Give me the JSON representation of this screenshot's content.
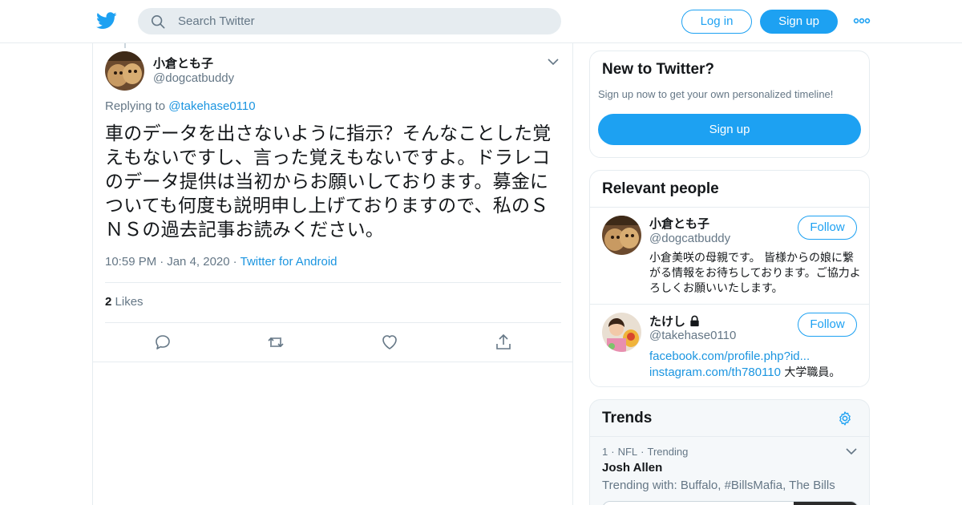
{
  "topbar": {
    "logo_icon": "twitter-bird-icon",
    "search_placeholder": "Search Twitter",
    "login_label": "Log in",
    "signup_label": "Sign up",
    "more_icon": "more-dots-icon",
    "brand_color": "#1da1f2"
  },
  "tweet": {
    "display_name": "小倉とも子",
    "screen_name": "@dogcatbuddy",
    "replying_prefix": "Replying to",
    "replying_to": "@takehase0110",
    "text": "車のデータを出さないように指示？そんなことした覚えもないですし、言った覚えもないですよ。ドラレコのデータ提供は当初からお願いしております。募金についても何度も説明申し上げておりますので、私のＳＮＳの過去記事お読みください。",
    "time": "10:59 PM",
    "date": "Jan 4, 2020",
    "source": "Twitter for Android",
    "likes_count": "2",
    "likes_label": "Likes",
    "actions": [
      "reply-icon",
      "retweet-icon",
      "like-icon",
      "share-icon"
    ]
  },
  "sidebar": {
    "new_to_twitter": {
      "title": "New to Twitter?",
      "subtitle": "Sign up now to get your own personalized timeline!",
      "button": "Sign up"
    },
    "relevant_people": {
      "title": "Relevant people",
      "people": [
        {
          "name": "小倉とも子",
          "handle": "@dogcatbuddy",
          "follow": "Follow",
          "bio": "小倉美咲の母親です。 皆様からの娘に繋がる情報をお待ちしております。ご協力よろしくお願いいたします。"
        },
        {
          "name": "たけし",
          "handle": "@takehase0110",
          "follow": "Follow",
          "protected": true,
          "bio_link1": "facebook.com/profile.php?id...",
          "bio_link2": "instagram.com/th780110",
          "bio_text": " 大学職員。"
        }
      ]
    },
    "trends": {
      "title": "Trends",
      "items": [
        {
          "rank": "1",
          "category": "NFL",
          "status": "Trending",
          "name": "Josh Allen",
          "with": "Trending with: Buffalo, #BillsMafia, The Bills"
        }
      ]
    }
  }
}
